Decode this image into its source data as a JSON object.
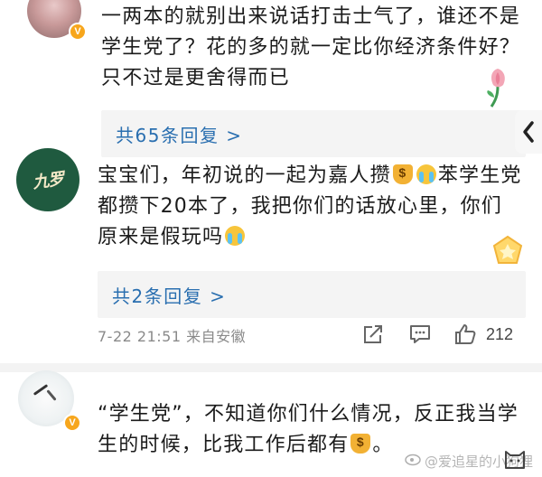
{
  "comments": [
    {
      "text": "一两本的就别出来说话打击士气了，谁还不是学生党了？花的多的就一定比你经济条件好？只不过是更舍得而已",
      "replies_label": "共65条回复 >"
    },
    {
      "text_before": "宝宝们，年初说的一起为嘉人攒",
      "text_after": "苯学生党都攒下20本了，我把你们的话放心里，你们原来是假玩吗",
      "replies_label": "共2条回复 >",
      "time": "7-22 21:51 来自安徽",
      "like_count": "212"
    },
    {
      "text_before": "“学生党”，不知道你们什么情况，反正我当学生的时候，比我工作后都有",
      "text_after": "。"
    }
  ],
  "avatar_logo_text": "九罗",
  "verified_badge": "V",
  "watermark": "@爱追星的小狗狸",
  "icons": {
    "share": "share-icon",
    "comment": "comment-icon",
    "like": "thumbs-up-icon",
    "side_tab": "chevron-left-icon"
  },
  "colors": {
    "link": "#2a6fb0",
    "meta": "#8a8a8a",
    "reply_bg": "#f4f4f4",
    "badge": "#f7a61c"
  }
}
